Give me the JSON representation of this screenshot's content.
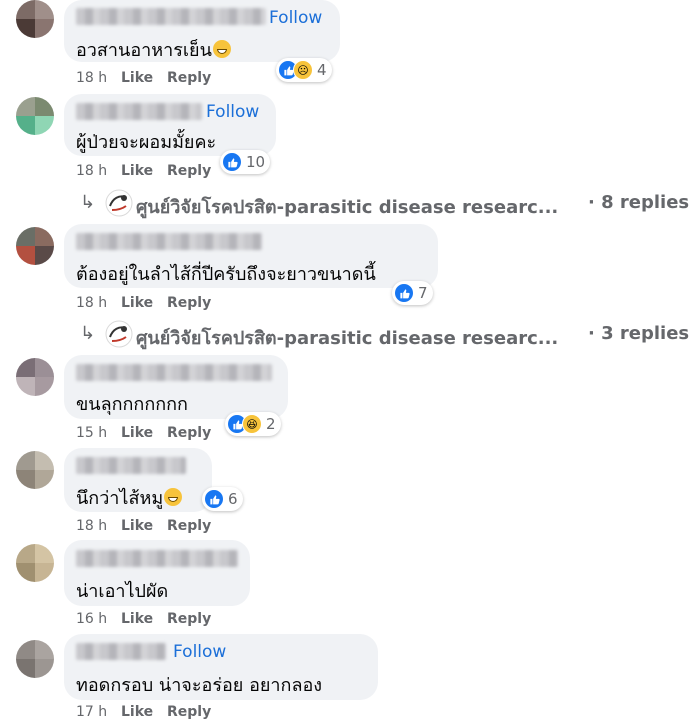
{
  "comments": [
    {
      "text": "อวสานอาหารเย็น",
      "time": "18 h",
      "like": "Like",
      "reply": "Reply",
      "follow": "Follow",
      "reaction_count": "4",
      "reactions": [
        "like-icon",
        "sad-icon"
      ],
      "has_emoji": true
    },
    {
      "text": "ผู้ป่วยจะผอมมั้ยคะ",
      "time": "18 h",
      "like": "Like",
      "reply": "Reply",
      "follow": "Follow",
      "reaction_count": "10",
      "reactions": [
        "like-icon"
      ],
      "has_emoji": false
    },
    {
      "text": "ต้องอยู่ในลำไส้กี่ปีครับถึงจะยาวขนาดนี้",
      "time": "18 h",
      "like": "Like",
      "reply": "Reply",
      "reaction_count": "7",
      "reactions": [
        "like-icon"
      ],
      "has_emoji": false
    },
    {
      "text": "ขนลุกกกกกกก",
      "time": "15 h",
      "like": "Like",
      "reply": "Reply",
      "reaction_count": "2",
      "reactions": [
        "like-icon",
        "haha-icon"
      ],
      "has_emoji": false
    },
    {
      "text": "นึกว่าไส้หมู",
      "time": "18 h",
      "like": "Like",
      "reply": "Reply",
      "reaction_count": "6",
      "reactions": [
        "like-icon"
      ],
      "has_emoji": true
    },
    {
      "text": "น่าเอาไปผัด",
      "time": "16 h",
      "like": "Like",
      "reply": "Reply"
    },
    {
      "text": "ทอดกรอบ น่าจะอร่อย อยากลอง",
      "time": "17 h",
      "like": "Like",
      "reply": "Reply",
      "follow": "Follow"
    }
  ],
  "reply_threads": [
    {
      "arrow": "↳",
      "page_name": "ศูนย์วิจัยโรคปรสิต-parasitic disease researc...",
      "count": "· 8 replies"
    },
    {
      "arrow": "↳",
      "page_name": "ศูนย์วิจัยโรคปรสิต-parasitic disease researc...",
      "count": "· 3 replies"
    }
  ],
  "colors": {
    "bubble": "#f0f2f5",
    "follow": "#1b6fd8",
    "meta": "#65676b",
    "like": "#1877f2"
  }
}
